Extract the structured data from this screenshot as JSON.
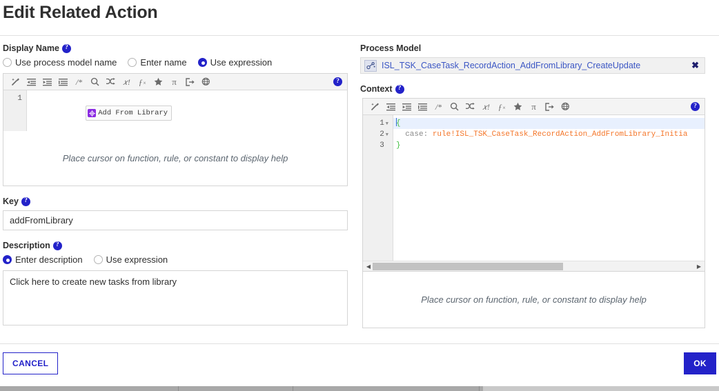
{
  "dialog": {
    "title": "Edit Related Action"
  },
  "display_name": {
    "label": "Display Name",
    "help_glyph": "?",
    "options": [
      {
        "label": "Use process model name",
        "selected": false
      },
      {
        "label": "Enter name",
        "selected": false
      },
      {
        "label": "Use expression",
        "selected": true
      }
    ],
    "editor": {
      "toolbar_icons": [
        "format-wand-icon",
        "indent-decrease-icon",
        "indent-increase-icon",
        "align-list-icon",
        "comment-icon",
        "search-icon",
        "shuffle-icon",
        "variable-icon",
        "function-icon",
        "favorite-star-icon",
        "pi-icon",
        "export-icon",
        "globe-link-icon"
      ],
      "help_icon": "help-icon",
      "line_numbers": [
        "1"
      ],
      "token_label": "Add From Library",
      "token_glyph": "rule-node-icon"
    },
    "help_text": "Place cursor on function, rule, or constant to display help"
  },
  "key": {
    "label": "Key",
    "help_glyph": "?",
    "value": "addFromLibrary",
    "placeholder": ""
  },
  "description": {
    "label": "Description",
    "help_glyph": "?",
    "options": [
      {
        "label": "Enter description",
        "selected": true
      },
      {
        "label": "Use expression",
        "selected": false
      }
    ],
    "value": "Click here to create new tasks from library",
    "placeholder": ""
  },
  "process_model": {
    "label": "Process Model",
    "chip_icon": "process-model-icon",
    "name": "ISL_TSK_CaseTask_RecordAction_AddFromLibrary_CreateUpdate",
    "remove_glyph": "✖"
  },
  "context": {
    "label": "Context",
    "help_glyph": "?",
    "editor": {
      "toolbar_icons": [
        "format-wand-icon",
        "indent-decrease-icon",
        "indent-increase-icon",
        "align-list-icon",
        "comment-icon",
        "search-icon",
        "shuffle-icon",
        "variable-icon",
        "function-icon",
        "favorite-star-icon",
        "pi-icon",
        "export-icon",
        "globe-link-icon"
      ],
      "help_icon": "help-icon",
      "lines": [
        {
          "num": "1",
          "foldable": true,
          "open": "{",
          "key": "",
          "rule": ""
        },
        {
          "num": "2",
          "foldable": true,
          "open": "",
          "key": "  case:",
          "rule": " rule!ISL_TSK_CaseTask_RecordAction_AddFromLibrary_Initia"
        },
        {
          "num": "3",
          "foldable": false,
          "open": "}",
          "key": "",
          "rule": ""
        }
      ],
      "scroll_left_glyph": "◀",
      "scroll_right_glyph": "▶"
    },
    "help_text": "Place cursor on function, rule, or constant to display help"
  },
  "footer": {
    "cancel_label": "CANCEL",
    "ok_label": "OK"
  },
  "colors": {
    "accent": "#2322c9",
    "link": "#3b56c4",
    "rule_token": "#f4762a",
    "brace_token": "#3fbf3f",
    "chip_purple": "#8b2be2"
  }
}
